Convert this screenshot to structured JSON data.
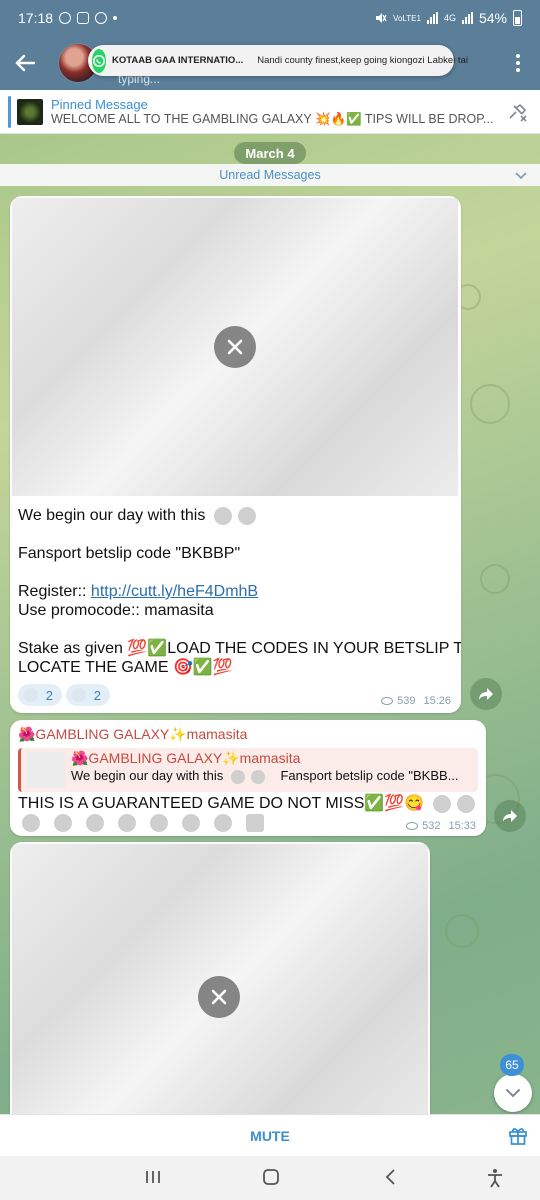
{
  "status_bar": {
    "time": "17:18",
    "network": "VoLTE1",
    "network2": "4G",
    "battery": "54%"
  },
  "header": {
    "subtitle": "typing..."
  },
  "notification": {
    "app": "WhatsApp",
    "title": "KOTAAB GAA INTERNATIO...",
    "text": "Nandi county finest,keep going kiongozi Labkei tai"
  },
  "pinned": {
    "title": "Pinned Message",
    "text": "WELCOME ALL TO THE GAMBLING GALAXY 💥🔥✅ TIPS WILL BE DROP..."
  },
  "chat": {
    "date": "March 4",
    "unread_label": "Unread Messages",
    "message1": {
      "line1": "We begin our day with this",
      "line2": "Fansport betslip code \"BKBBP\"",
      "register_label": "Register::",
      "register_link": "http://cutt.ly/heF4DmhB",
      "promo": "Use promocode:: mamasita",
      "stake_line1": "Stake as given 💯✅LOAD THE CODES IN YOUR BETSLIP TO",
      "stake_line2": "LOCATE THE GAME 🎯✅💯",
      "reaction1_count": "2",
      "reaction2_count": "2",
      "views": "539",
      "time": "15:26"
    },
    "message2": {
      "sender": "🌺GAMBLING GALAXY✨mamasita",
      "quote_sender": "🌺GAMBLING GALAXY✨mamasita",
      "quote_text": "We begin our day with this",
      "quote_text2": "Fansport betslip code \"BKBB...",
      "text": "THIS IS A GUARANTEED GAME DO NOT MISS✅💯😋",
      "views": "532",
      "time": "15:33"
    },
    "unread_badge": "65"
  },
  "bottom": {
    "mute_label": "MUTE"
  },
  "colors": {
    "header": "#5b7e99",
    "accent": "#3b8fd0",
    "sender": "#c64a3f"
  }
}
